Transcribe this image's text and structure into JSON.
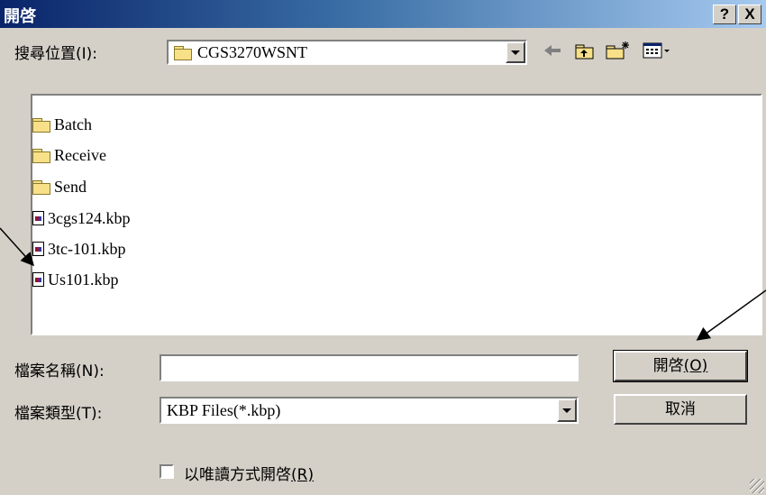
{
  "window": {
    "title": "開啓"
  },
  "titlebar": {
    "help_label": "?",
    "close_label": "X"
  },
  "lookin": {
    "label": "搜尋位置",
    "shortcut": "(I):",
    "value": "CGS3270WSNT"
  },
  "files": [
    {
      "name": "Batch",
      "icon": "folder-icon"
    },
    {
      "name": "Receive",
      "icon": "folder-icon"
    },
    {
      "name": "Send",
      "icon": "folder-icon"
    },
    {
      "name": "3cgs124.kbp",
      "icon": "kbp-file-icon"
    },
    {
      "name": "3tc-101.kbp",
      "icon": "kbp-file-icon"
    },
    {
      "name": "Us101.kbp",
      "icon": "kbp-file-icon"
    }
  ],
  "filename": {
    "label": "檔案名稱",
    "shortcut": "(N):",
    "value": ""
  },
  "filetype": {
    "label": "檔案類型",
    "shortcut": "(T):",
    "value": "KBP Files(*.kbp)"
  },
  "buttons": {
    "open_label": "開啓",
    "open_key": "(O)",
    "cancel_label": "取消"
  },
  "readonly": {
    "label": "以唯讀方式開啓",
    "key": "(R)",
    "checked": false
  },
  "colors": {
    "face": "#d4d0c8",
    "title_start": "#0a246a",
    "title_end": "#a6caf0"
  }
}
